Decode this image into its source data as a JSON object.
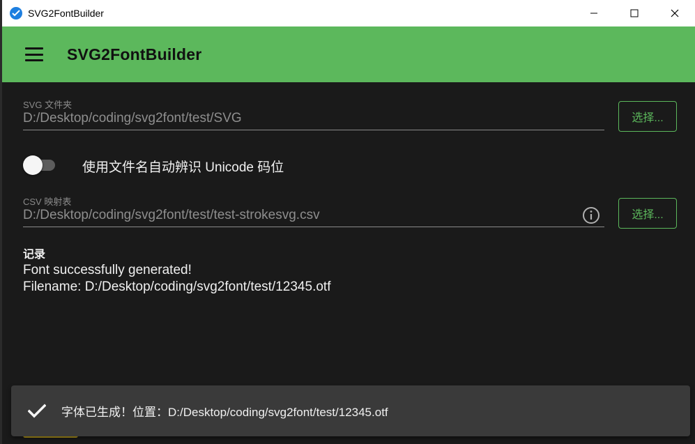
{
  "window": {
    "title": "SVG2FontBuilder"
  },
  "appbar": {
    "title": "SVG2FontBuilder"
  },
  "svg_folder": {
    "label": "SVG 文件夹",
    "value": "D:/Desktop/coding/svg2font/test/SVG",
    "button": "选择..."
  },
  "auto_unicode": {
    "label": "使用文件名自动辨识 Unicode 码位",
    "enabled": false
  },
  "csv_map": {
    "label": "CSV 映射表",
    "value": "D:/Desktop/coding/svg2font/test/test-strokesvg.csv",
    "button": "选择..."
  },
  "log": {
    "title": "记录",
    "lines": [
      "Font successfully generated!",
      "Filename: D:/Desktop/coding/svg2font/test/12345.otf"
    ]
  },
  "snackbar": {
    "icon": "check-icon",
    "message": "字体已生成！位置：D:/Desktop/coding/svg2font/test/12345.otf"
  },
  "colors": {
    "accent": "#5cb85c",
    "background": "#1a1a1a",
    "snackbar": "#3a3a3a"
  }
}
